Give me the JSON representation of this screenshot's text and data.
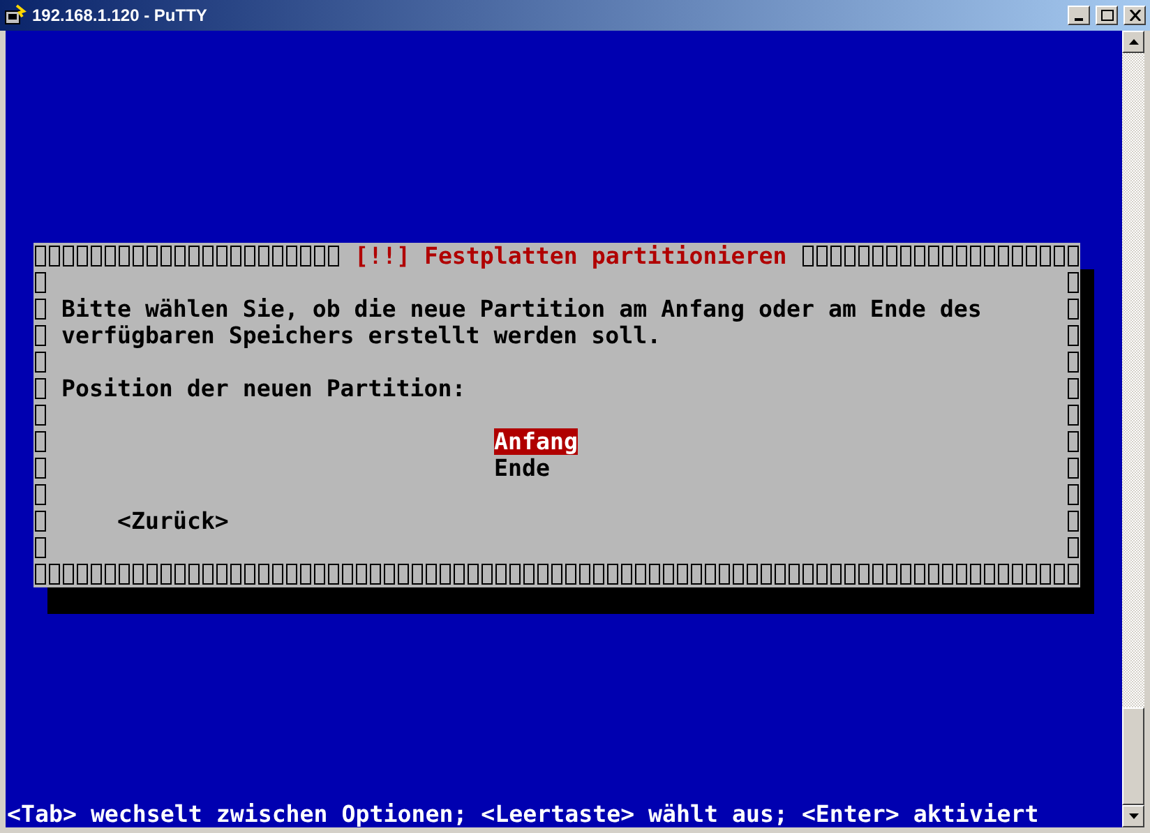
{
  "window": {
    "title": "192.168.1.120 - PuTTY"
  },
  "dialog": {
    "title": "[!!] Festplatten partitionieren",
    "message_lines": [
      "Bitte wählen Sie, ob die neue Partition am Anfang oder am Ende des",
      "verfügbaren Speichers erstellt werden soll."
    ],
    "prompt": "Position der neuen Partition:",
    "options": [
      {
        "label": "Anfang",
        "selected": true
      },
      {
        "label": "Ende",
        "selected": false
      }
    ],
    "back_button": "<Zurück>"
  },
  "status_line": "<Tab> wechselt zwischen Optionen; <Leertaste> wählt aus; <Enter> aktiviert"
}
